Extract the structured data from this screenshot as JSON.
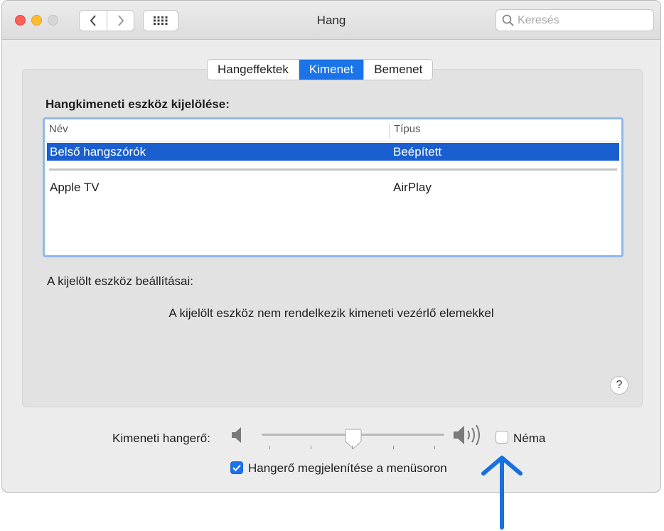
{
  "window": {
    "title": "Hang"
  },
  "search": {
    "placeholder": "Keresés"
  },
  "tabs": [
    {
      "label": "Hangeffektek",
      "active": false
    },
    {
      "label": "Kimenet",
      "active": true
    },
    {
      "label": "Bemenet",
      "active": false
    }
  ],
  "output": {
    "heading": "Hangkimeneti eszköz kijelölése:",
    "columns": {
      "name": "Név",
      "type": "Típus"
    },
    "rows": [
      {
        "name": "Belső hangszórók",
        "type": "Beépített",
        "selected": true
      },
      {
        "name": "Apple TV",
        "type": "AirPlay",
        "selected": false
      }
    ],
    "settings_label": "A kijelölt eszköz beállításai:",
    "no_controls_text": "A kijelölt eszköz nem rendelkezik kimeneti vezérlő elemekkel"
  },
  "help": {
    "label": "?"
  },
  "volume": {
    "label": "Kimeneti hangerő:",
    "level_fraction": 0.5,
    "mute_label": "Néma",
    "mute_checked": false,
    "show_in_menubar_label": "Hangerő megjelenítése a menüsoron",
    "show_in_menubar_checked": true
  },
  "colors": {
    "accent": "#1a73e8",
    "selection": "#1a5fd0",
    "annotation_arrow": "#1a6fe0"
  },
  "icons": {
    "back": "chevron-left-icon",
    "forward": "chevron-right-icon",
    "grid": "grid-icon",
    "search": "magnifier-icon",
    "volume_low": "speaker-low-icon",
    "volume_high": "speaker-high-icon"
  }
}
